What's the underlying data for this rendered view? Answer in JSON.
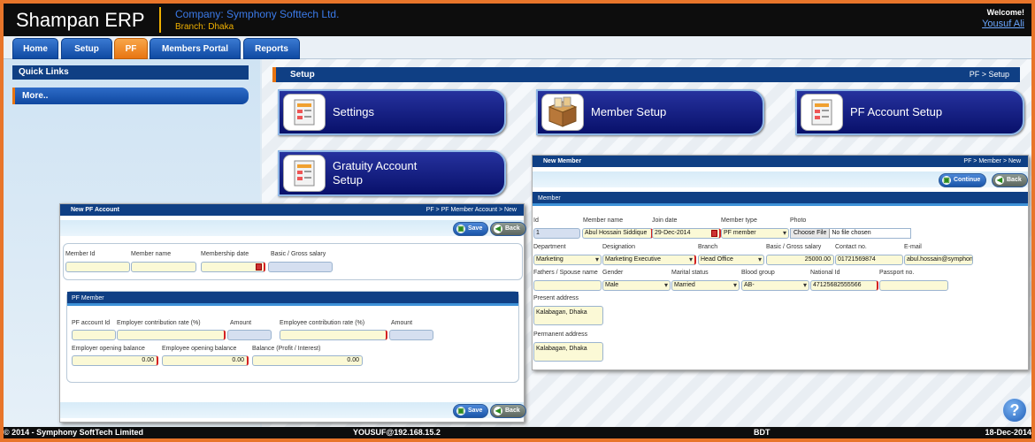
{
  "header": {
    "app_title": "Shampan ERP",
    "company": "Company: Symphony Softtech Ltd.",
    "branch": "Branch: Dhaka",
    "welcome": "Welcome!",
    "user": "Yousuf Ali"
  },
  "nav": {
    "tabs": [
      {
        "label": "Home"
      },
      {
        "label": "Setup"
      },
      {
        "label": "PF",
        "active": true
      },
      {
        "label": "Members Portal"
      },
      {
        "label": "Reports"
      }
    ]
  },
  "quick_links": {
    "title": "Quick Links",
    "more": "More.."
  },
  "setup": {
    "title": "Setup",
    "breadcrumb": "PF > Setup",
    "tiles": [
      {
        "label": "Settings",
        "icon": "settings-doc-icon"
      },
      {
        "label": "Member Setup",
        "icon": "member-box-icon"
      },
      {
        "label": "PF Account Setup",
        "icon": "pf-account-doc-icon"
      },
      {
        "label": "Gratuity Account Setup",
        "icon": "gratuity-doc-icon"
      }
    ]
  },
  "new_pf_account": {
    "title": "New PF Account",
    "breadcrumb": "PF > PF Member Account > New",
    "save": "Save",
    "back": "Back",
    "labels": {
      "member_id": "Member Id",
      "member_name": "Member name",
      "membership_date": "Membership date",
      "basic_salary": "Basic / Gross salary"
    },
    "pf_member": {
      "title": "PF Member",
      "pf_account_id": "PF account Id",
      "employer_rate": "Employer contribution rate (%)",
      "amount": "Amount",
      "employee_rate": "Employee contribution rate (%)",
      "amount2": "Amount",
      "employer_opening": "Employer opening balance",
      "employee_opening": "Employee opening balance",
      "balance": "Balance (Profit / Interest)",
      "values": {
        "employer_opening": "0.00",
        "employee_opening": "0.00",
        "balance": "0.00"
      }
    }
  },
  "new_member": {
    "title": "New Member",
    "breadcrumb": "PF > Member > New",
    "continue": "Continue",
    "back": "Back",
    "section": "Member",
    "labels": {
      "id": "Id",
      "member_name": "Member name",
      "join_date": "Join date",
      "member_type": "Member type",
      "photo": "Photo",
      "department": "Department",
      "designation": "Designation",
      "branch": "Branch",
      "salary": "Basic / Gross salary",
      "contact": "Contact no.",
      "email": "E-mail",
      "father": "Fathers / Spouse name",
      "gender": "Gender",
      "marital": "Marital status",
      "blood": "Blood group",
      "nid": "National Id",
      "passport": "Passport no.",
      "present_address": "Present address",
      "permanent_address": "Permanent address"
    },
    "values": {
      "id": "1",
      "member_name": "Abul Hossain Siddique",
      "join_date": "29-Dec-2014",
      "member_type": "PF member",
      "choose_file": "Choose File",
      "no_file": "No file chosen",
      "department": "Marketing",
      "designation": "Marketing Executive",
      "branch": "Head Office",
      "salary": "25000.00",
      "contact": "01721569874",
      "email": "abul.hossain@symphony",
      "father": "",
      "gender": "Male",
      "marital": "Married",
      "blood": "AB-",
      "nid": "47125682555566",
      "passport": "",
      "present_address": "Kalabagan, Dhaka",
      "permanent_address": "Kalabagan, Dhaka"
    }
  },
  "footer": {
    "copyright": "© 2014 - Symphony SoftTech Limited",
    "user_ip": "YOUSUF@192.168.15.2",
    "currency": "BDT",
    "date": "18-Dec-2014"
  },
  "help": "?"
}
